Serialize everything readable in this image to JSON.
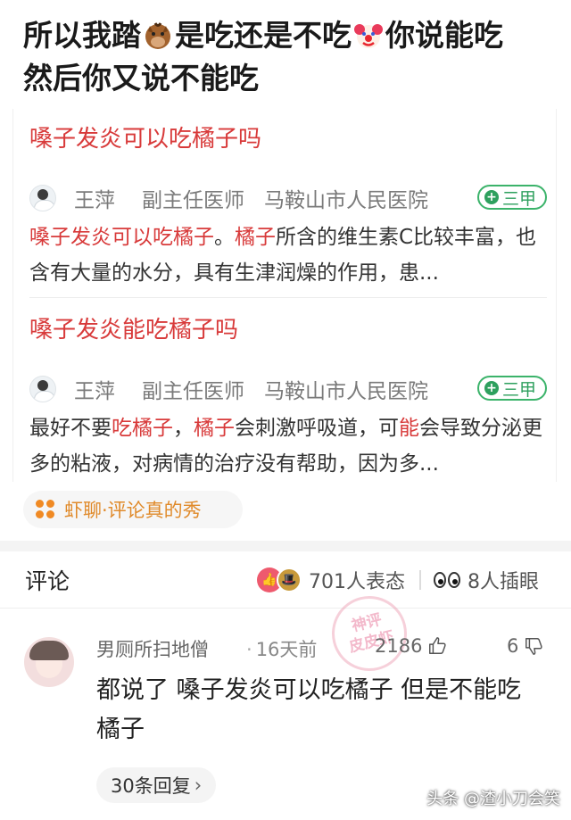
{
  "post": {
    "title_part1": "所以我踏",
    "emoji1": "horse-emoji",
    "title_part2": "是吃还是不吃",
    "emoji2": "clown-emoji",
    "title_part3": "你说能吃",
    "title_line2": "然后你又说不能吃"
  },
  "results": [
    {
      "title": "嗓子发炎可以吃橘子吗",
      "doctor_name": "王萍",
      "doctor_title": "副主任医师",
      "hospital": "马鞍山市人民医院",
      "badge": "三甲",
      "snippet": [
        {
          "t": "嗓子发炎可以吃橘子",
          "hl": true
        },
        {
          "t": "。",
          "hl": false
        },
        {
          "t": "橘子",
          "hl": true
        },
        {
          "t": "所含的维生素C比较丰富，也含有大量的水分，具有生津润燥的作用，患...",
          "hl": false
        }
      ]
    },
    {
      "title": "嗓子发炎能吃橘子吗",
      "doctor_name": "王萍",
      "doctor_title": "副主任医师",
      "hospital": "马鞍山市人民医院",
      "badge": "三甲",
      "snippet": [
        {
          "t": "最好不要",
          "hl": false
        },
        {
          "t": "吃橘子",
          "hl": true
        },
        {
          "t": "，",
          "hl": false
        },
        {
          "t": "橘子",
          "hl": true
        },
        {
          "t": "会刺激呼吸道，可",
          "hl": false
        },
        {
          "t": "能",
          "hl": true
        },
        {
          "t": "会导致分泌更多的粘液，对病情的治疗没有帮助，因为多...",
          "hl": false
        }
      ]
    }
  ],
  "source_chip": {
    "label": "虾聊·评论真的秀",
    "icon": "four-dots-icon",
    "color": "#e08a2a"
  },
  "comments_header": {
    "title": "评论",
    "reactions_count": "701人表态",
    "eyes_count": "8人插眼"
  },
  "comment": {
    "username": "男厕所扫地僧",
    "time": "16天前",
    "likes": "2186",
    "dislikes": "6",
    "text": "都说了 嗓子发炎可以吃橘子 但是不能吃橘子",
    "replies": "30条回复"
  },
  "stamp": {
    "line1": "神评",
    "line2": "皮皮虾"
  },
  "watermark": "头条 @渣小刀会笑",
  "colors": {
    "highlight": "#d83a3a",
    "badge_green": "#2ea05e",
    "chip_orange": "#e08a2a"
  }
}
